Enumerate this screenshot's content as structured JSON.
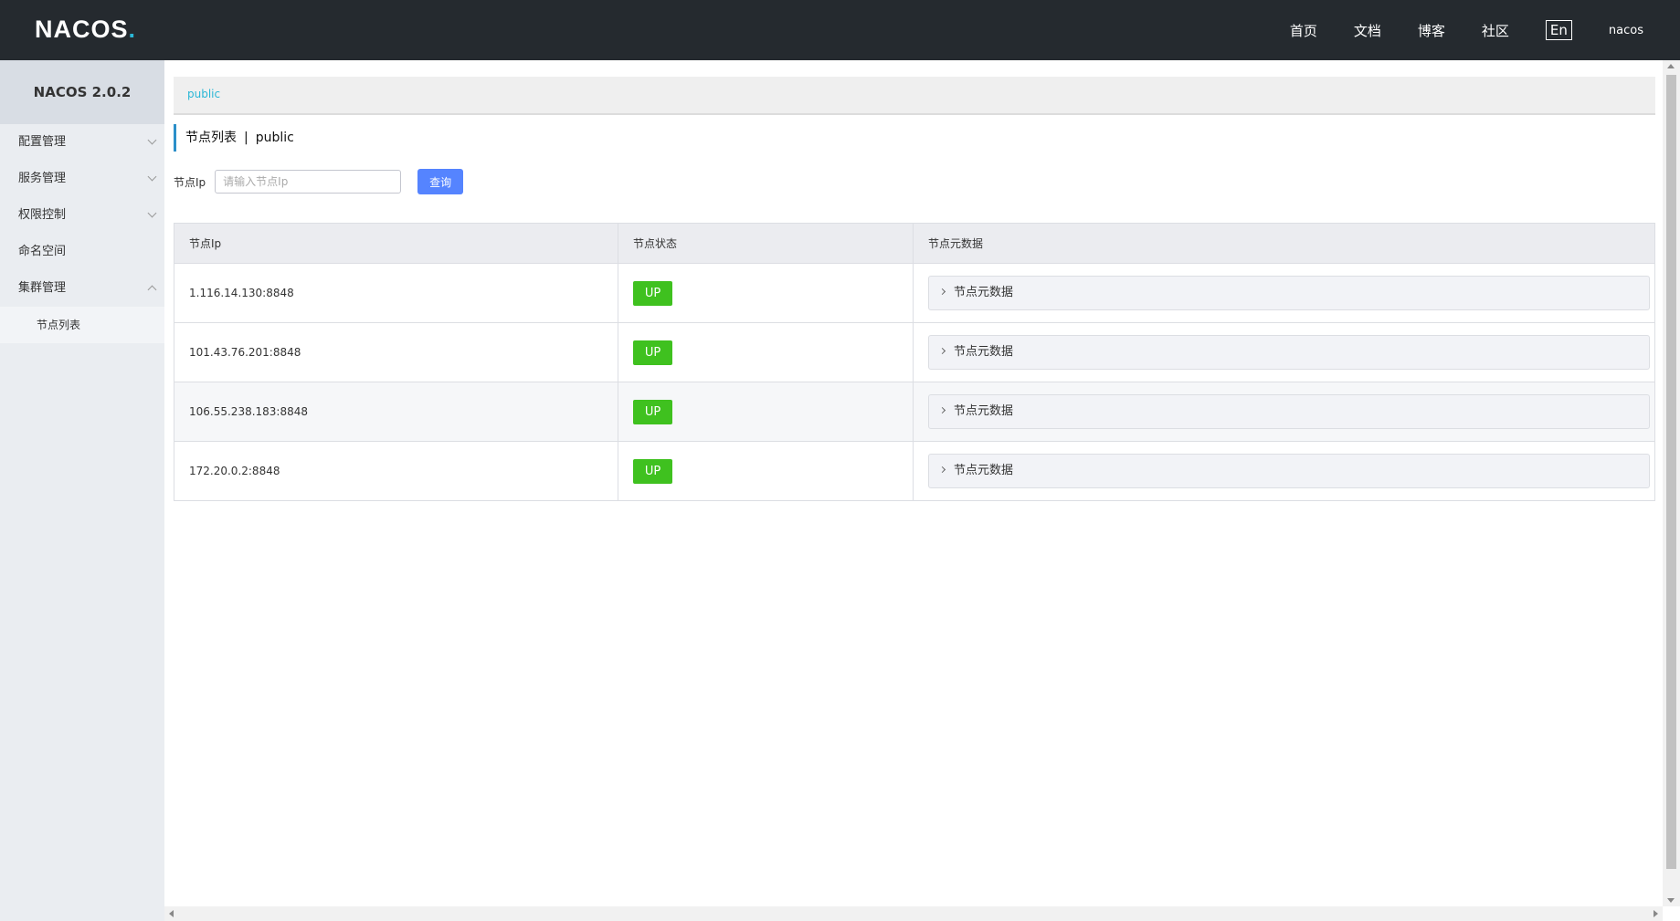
{
  "header": {
    "logo_main": "NACOS",
    "logo_dot": ".",
    "nav": [
      "首页",
      "文档",
      "博客",
      "社区"
    ],
    "lang": "En",
    "user": "nacos"
  },
  "sidebar": {
    "title": "NACOS 2.0.2",
    "items": [
      {
        "label": "配置管理",
        "expanded": false
      },
      {
        "label": "服务管理",
        "expanded": false
      },
      {
        "label": "权限控制",
        "expanded": false
      },
      {
        "label": "命名空间"
      },
      {
        "label": "集群管理",
        "expanded": true
      }
    ],
    "subitems": [
      "节点列表"
    ]
  },
  "breadcrumb": {
    "namespace": "public"
  },
  "page": {
    "title": "节点列表",
    "separator": "|",
    "namespace": "public"
  },
  "search": {
    "label": "节点Ip",
    "placeholder": "请输入节点Ip",
    "button": "查询"
  },
  "table": {
    "columns": [
      "节点Ip",
      "节点状态",
      "节点元数据"
    ],
    "rows": [
      {
        "ip": "1.116.14.130:8848",
        "status": "UP",
        "meta": "节点元数据"
      },
      {
        "ip": "101.43.76.201:8848",
        "status": "UP",
        "meta": "节点元数据"
      },
      {
        "ip": "106.55.238.183:8848",
        "status": "UP",
        "meta": "节点元数据"
      },
      {
        "ip": "172.20.0.2:8848",
        "status": "UP",
        "meta": "节点元数据"
      }
    ]
  },
  "colors": {
    "topbar": "#252a2f",
    "accent": "#2bb7d6",
    "primary_button": "#5584ff",
    "status_up": "#3fc11f"
  }
}
